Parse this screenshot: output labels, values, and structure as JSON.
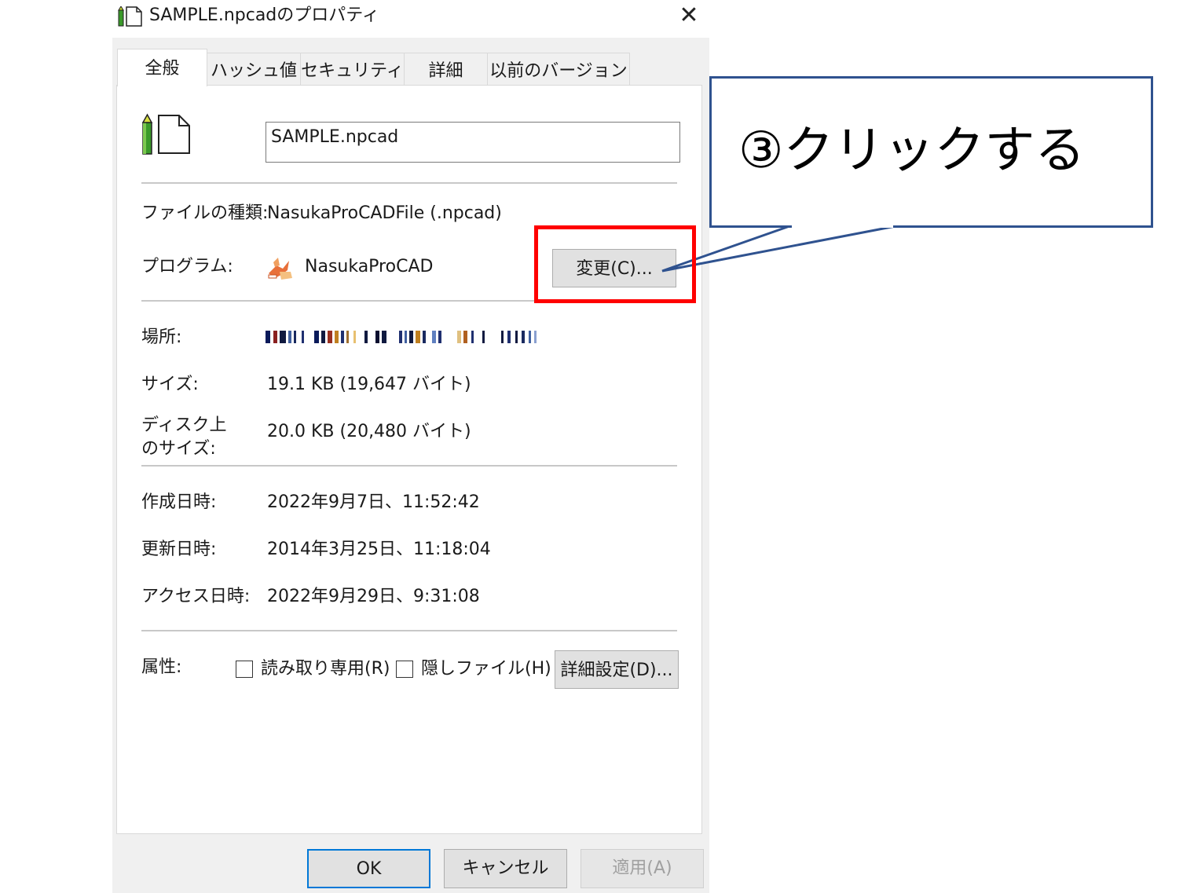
{
  "window": {
    "title": "SAMPLE.npcadのプロパティ",
    "close_glyph": "✕"
  },
  "tabs": [
    {
      "label": "全般",
      "active": true
    },
    {
      "label": "ハッシュ値",
      "active": false
    },
    {
      "label": "セキュリティ",
      "active": false
    },
    {
      "label": "詳細",
      "active": false
    },
    {
      "label": "以前のバージョン",
      "active": false
    }
  ],
  "general": {
    "file_name_value": "SAMPLE.npcad",
    "file_type_label": "ファイルの種類:",
    "file_type_value": "NasukaProCADFile (.npcad)",
    "program_label": "プログラム:",
    "program_value": "NasukaProCAD",
    "change_button_label": "変更(C)...",
    "location_label": "場所:",
    "size_label": "サイズ:",
    "size_value": "19.1 KB (19,647 バイト)",
    "disk_size_label_line1": "ディスク上",
    "disk_size_label_line2": "のサイズ:",
    "disk_size_value": "20.0 KB (20,480 バイト)",
    "created_label": "作成日時:",
    "created_value": "2022年9月7日、11:52:42",
    "modified_label": "更新日時:",
    "modified_value": "2014年3月25日、11:18:04",
    "accessed_label": "アクセス日時:",
    "accessed_value": "2022年9月29日、9:31:08",
    "attributes_label": "属性:",
    "readonly_label": "読み取り専用(R)",
    "hidden_label": "隠しファイル(H)",
    "advanced_button_label": "詳細設定(D)..."
  },
  "footer": {
    "ok_label": "OK",
    "cancel_label": "キャンセル",
    "apply_label": "適用(A)"
  },
  "annotation": {
    "callout_text": "③クリックする",
    "highlight_color": "#ff0000",
    "callout_border_color": "#2f528f"
  },
  "icons": {
    "file_icon": "npcad-file-icon",
    "program_icon": "nasukaprocad-app-icon",
    "location_redacted": "mosaic-bar"
  }
}
